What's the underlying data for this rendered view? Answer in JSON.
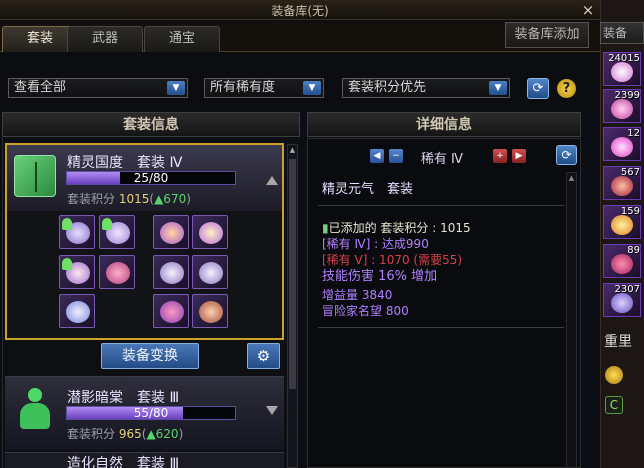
{
  "window": {
    "title": "装备库(无)",
    "close": "×"
  },
  "tabs": [
    "套装",
    "武器",
    "通宝"
  ],
  "add_button": "装备库添加",
  "filters": {
    "view": "查看全部",
    "rarity": "所有稀有度",
    "sort": "套装积分优先"
  },
  "left_panel": {
    "title": "套装信息"
  },
  "right_panel": {
    "title": "详细信息"
  },
  "set1": {
    "name": "精灵国度　套装 Ⅳ",
    "progress_text": "25/80",
    "progress": 0.3125,
    "points_label": "套装积分",
    "points_value": "1015",
    "points_delta": "▲670",
    "swap_button": "装备变换"
  },
  "set2": {
    "name": "潜影暗棠　套装 Ⅲ",
    "progress_text": "55/80",
    "progress": 0.6875,
    "points_label": "套装积分",
    "points_value": "965",
    "points_delta": "▲620"
  },
  "set3": {
    "name": "造化自然　套装 Ⅲ"
  },
  "detail": {
    "rarity": "稀有 Ⅳ",
    "set_title": "精灵元气　套装",
    "added_label": "已添加的 套装积分 :",
    "added_value": "1015",
    "rare4": "[稀有 Ⅳ] : 达成990",
    "rare5": "[稀有 Ⅴ] : 1070 (需要55)",
    "stat1": "技能伤害 16% 增加",
    "stat2": "增益量 3840",
    "stat3": "冒险家名望 800"
  },
  "sidebar": {
    "add": "装备",
    "counts": [
      "24015",
      "2399",
      "12",
      "567",
      "159",
      "89",
      "2307"
    ],
    "weight": "重里"
  },
  "colors": {
    "gold_border": "#c9a227",
    "rare5_red": "#d8404a",
    "rare4_purple": "#b080ff",
    "points_green": "#59d46a"
  }
}
